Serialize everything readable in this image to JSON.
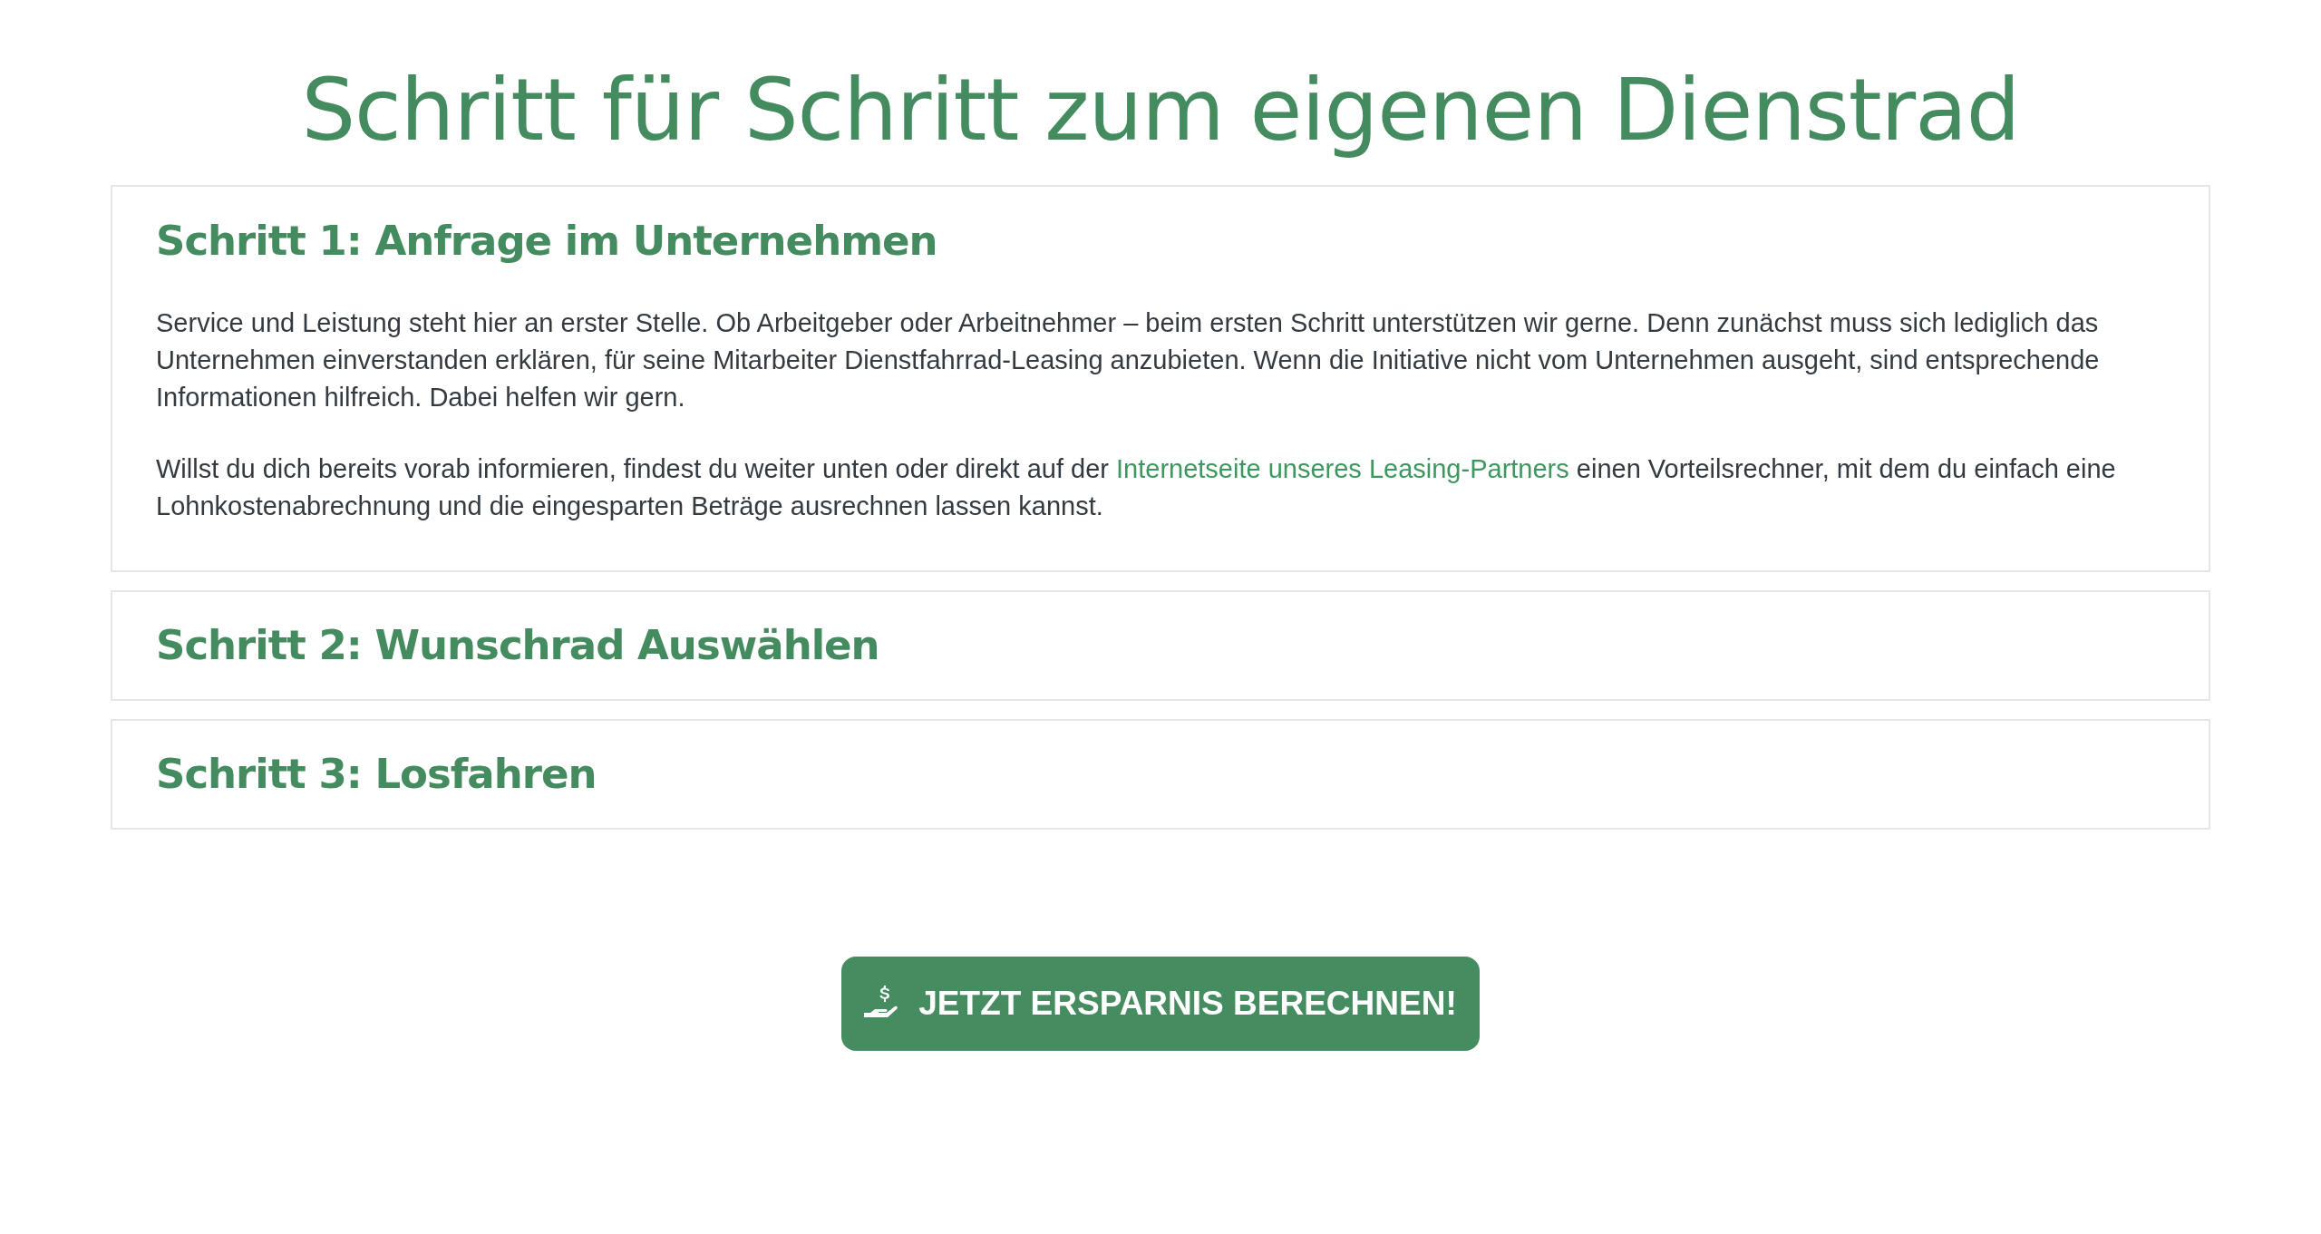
{
  "title": "Schritt für Schritt zum eigenen Dienstrad",
  "steps": [
    {
      "heading": "Schritt 1: Anfrage im Unternehmen",
      "expanded": true,
      "paragraphs": [
        {
          "before": "Service und Leistung steht hier an erster Stelle. Ob Arbeitgeber oder Arbeitnehmer – beim ersten Schritt unterstützen wir gerne. Denn zunächst muss sich lediglich das Unternehmen einverstanden erklären, für seine Mitarbeiter Dienstfahrrad-Leasing anzubieten. Wenn die Initiative nicht vom Unternehmen ausgeht, sind entsprechende Informationen hilfreich. Dabei helfen wir gern."
        },
        {
          "before": "Willst du dich bereits vorab informieren, findest du weiter unten oder direkt auf der ",
          "link": "Internetseite unseres Leasing-Partners",
          "after": " einen Vorteilsrechner, mit dem du einfach eine Lohnkostenabrechnung und die eingesparten Beträge ausrechnen lassen kannst."
        }
      ]
    },
    {
      "heading": "Schritt 2: Wunschrad Auswählen",
      "expanded": false
    },
    {
      "heading": "Schritt 3: Losfahren",
      "expanded": false
    }
  ],
  "button": "JETZT ERSPARNIS BERECHNEN!"
}
